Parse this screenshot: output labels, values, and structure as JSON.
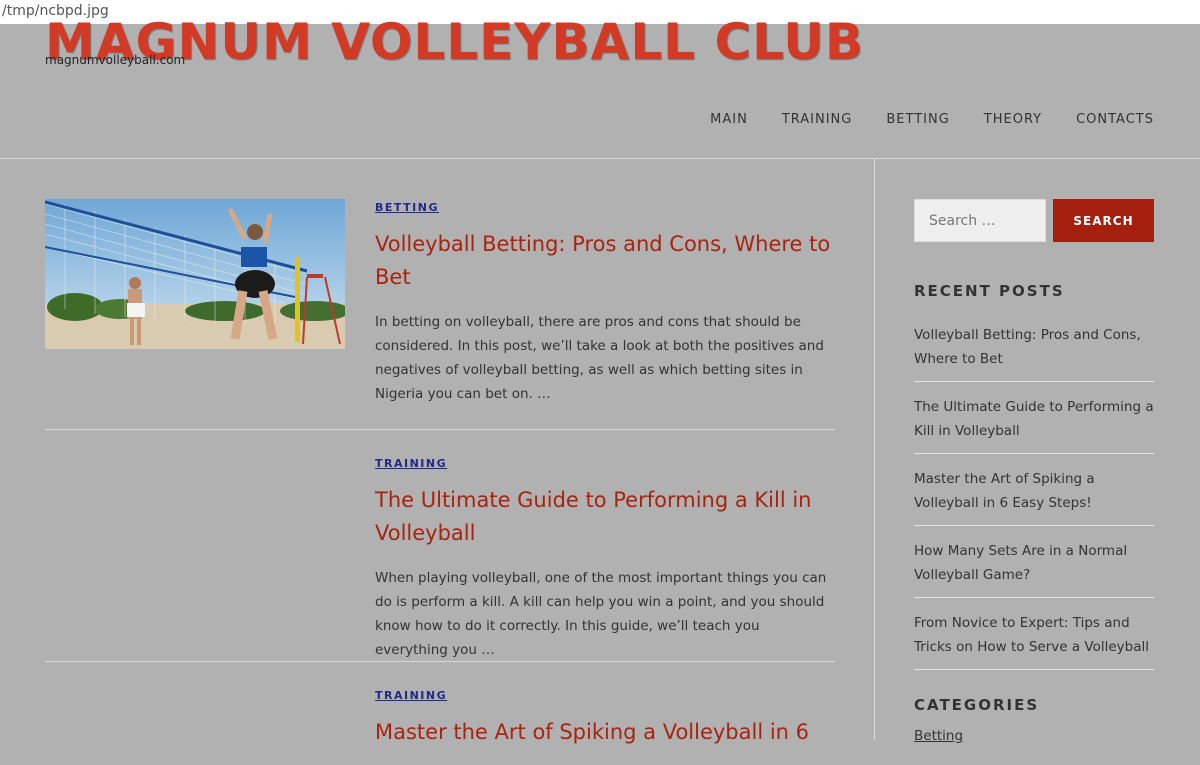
{
  "window": {
    "path": "/tmp/ncbpd.jpg"
  },
  "site": {
    "title": "MAGNUM VOLLEYBALL CLUB",
    "description": "magnumvolleyball.com",
    "accent": "#d23a25"
  },
  "nav": {
    "items": [
      {
        "label": "MAIN"
      },
      {
        "label": "TRAINING"
      },
      {
        "label": "BETTING"
      },
      {
        "label": "THEORY"
      },
      {
        "label": "CONTACTS"
      }
    ]
  },
  "posts": [
    {
      "category": "BETTING",
      "title": "Volleyball Betting: Pros and Cons, Where to Bet",
      "excerpt": "In betting on volleyball, there are pros and cons that should be considered. In this post, we’ll take a look at both the positives and negatives of volleyball betting, as well as which betting sites in Nigeria you can bet on. …",
      "thumbnail": "beach-volleyball-photo"
    },
    {
      "category": "TRAINING",
      "title": "The Ultimate Guide to Performing a Kill in Volleyball",
      "excerpt": "When playing volleyball, one of the most important things you can do is perform a kill. A kill can help you win a point, and you should know how to do it correctly. In this guide, we’ll teach you everything you …"
    },
    {
      "category": "TRAINING",
      "title": "Master the Art of Spiking a Volleyball in 6"
    }
  ],
  "sidebar": {
    "search": {
      "placeholder": "Search …",
      "button": "SEARCH"
    },
    "recent_title": "RECENT POSTS",
    "recent": [
      "Volleyball Betting: Pros and Cons, Where to Bet",
      "The Ultimate Guide to Performing a Kill in Volleyball",
      "Master the Art of Spiking a Volleyball in 6 Easy Steps!",
      "How Many Sets Are in a Normal Volleyball Game?",
      "From Novice to Expert: Tips and Tricks on How to Serve a Volleyball"
    ],
    "categories_title": "CATEGORIES",
    "categories": [
      "Betting"
    ]
  },
  "colors": {
    "background": "#b1b1b1",
    "title_red": "#a8240e",
    "category_blue": "#1e2a8c",
    "button_red": "#a3200f"
  }
}
